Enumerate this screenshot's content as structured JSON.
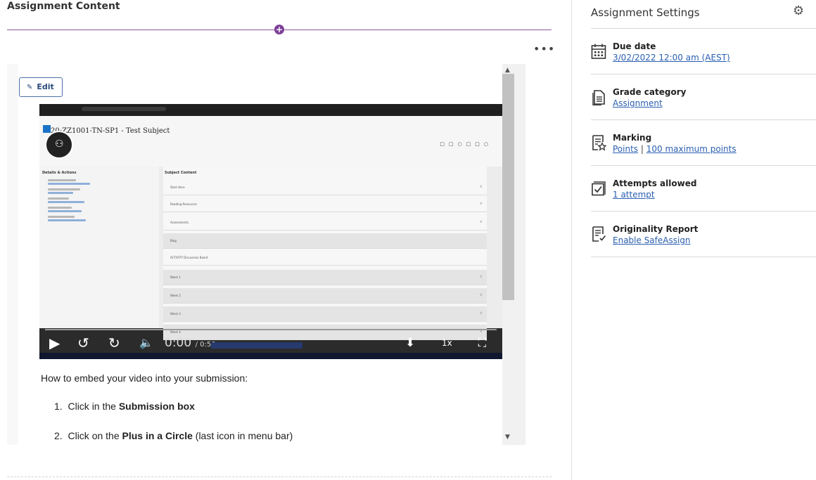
{
  "content": {
    "title": "Assignment Content",
    "plus_icon": "+",
    "more_label": "•••",
    "edit_label": "Edit",
    "scroll_up": "▲",
    "scroll_down": "▼"
  },
  "video": {
    "course_title": "20-ZZ1001-TN-SP1 - Test Subject",
    "panels": {
      "left_title": "Details & Actions",
      "right_title": "Subject Content"
    },
    "folders": [
      "Start Here",
      "Reading Resources",
      "Assessments"
    ],
    "blank_item": "Blog",
    "discussion_item": "ACTIVITY Discussion Board",
    "weeks": [
      "Week 1",
      "Week 2",
      "Week 3",
      "Week 4"
    ],
    "controls": {
      "time_current": "0:00",
      "time_total": "/ 0:58",
      "rate": "1x"
    }
  },
  "instructions": {
    "intro": "How to embed your video into your submission:",
    "steps": [
      {
        "number": "1.",
        "prefix": "Click in the ",
        "bold": "Submission box",
        "suffix": ""
      },
      {
        "number": "2.",
        "prefix": "Click on the ",
        "bold": "Plus in a Circle",
        "suffix": " (last icon in menu bar)"
      }
    ]
  },
  "settings": {
    "title": "Assignment Settings",
    "items": [
      {
        "icon": "calendar-icon",
        "label": "Due date",
        "value": "3/02/2022 12:00 am (AEST)"
      },
      {
        "icon": "document-icon",
        "label": "Grade category",
        "value": "Assignment"
      },
      {
        "icon": "marking-icon",
        "label": "Marking",
        "value": "Points",
        "value2": "100 maximum points",
        "separator": "|"
      },
      {
        "icon": "checkbox-icon",
        "label": "Attempts allowed",
        "value": "1 attempt"
      },
      {
        "icon": "originality-icon",
        "label": "Originality Report",
        "value": "Enable SafeAssign"
      }
    ]
  },
  "colors": {
    "accent_purple": "#7d3f98",
    "link_blue": "#2a5fb0",
    "edit_border": "#4a6fa5"
  }
}
